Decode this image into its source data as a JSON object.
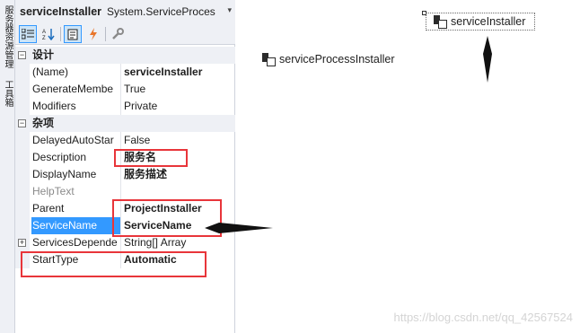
{
  "side_tabs": [
    "服务器资源管理器",
    "工具箱"
  ],
  "header": {
    "object_name": "serviceInstaller",
    "object_type": "System.ServiceProces"
  },
  "toolbar": {
    "buttons": [
      "categorized-icon",
      "alphabetical-icon",
      "properties-icon",
      "events-icon",
      "property-pages-icon"
    ]
  },
  "categories": [
    {
      "label": "设计",
      "rows": [
        {
          "name": "(Name)",
          "value": "serviceInstaller"
        },
        {
          "name": "GenerateMembe",
          "value": "True"
        },
        {
          "name": "Modifiers",
          "value": "Private"
        }
      ]
    },
    {
      "label": "杂项",
      "rows": [
        {
          "name": "DelayedAutoStar",
          "value": "False"
        },
        {
          "name": "Description",
          "value": "服务名"
        },
        {
          "name": "DisplayName",
          "value": "服务描述"
        },
        {
          "name": "HelpText",
          "value": ""
        },
        {
          "name": "Parent",
          "value": "ProjectInstaller"
        },
        {
          "name": "ServiceName",
          "value": "ServiceName"
        },
        {
          "name": "ServicesDepende",
          "value": "String[] Array"
        },
        {
          "name": "StartType",
          "value": "Automatic"
        }
      ]
    }
  ],
  "designer": {
    "component_selected": "serviceInstaller",
    "component_other": "serviceProcessInstaller"
  },
  "watermark": "https://blog.csdn.net/qq_42567524",
  "colors": {
    "selection": "#3399ff",
    "annotation_red": "#e8353a",
    "panel_bg": "#eef0f5"
  }
}
